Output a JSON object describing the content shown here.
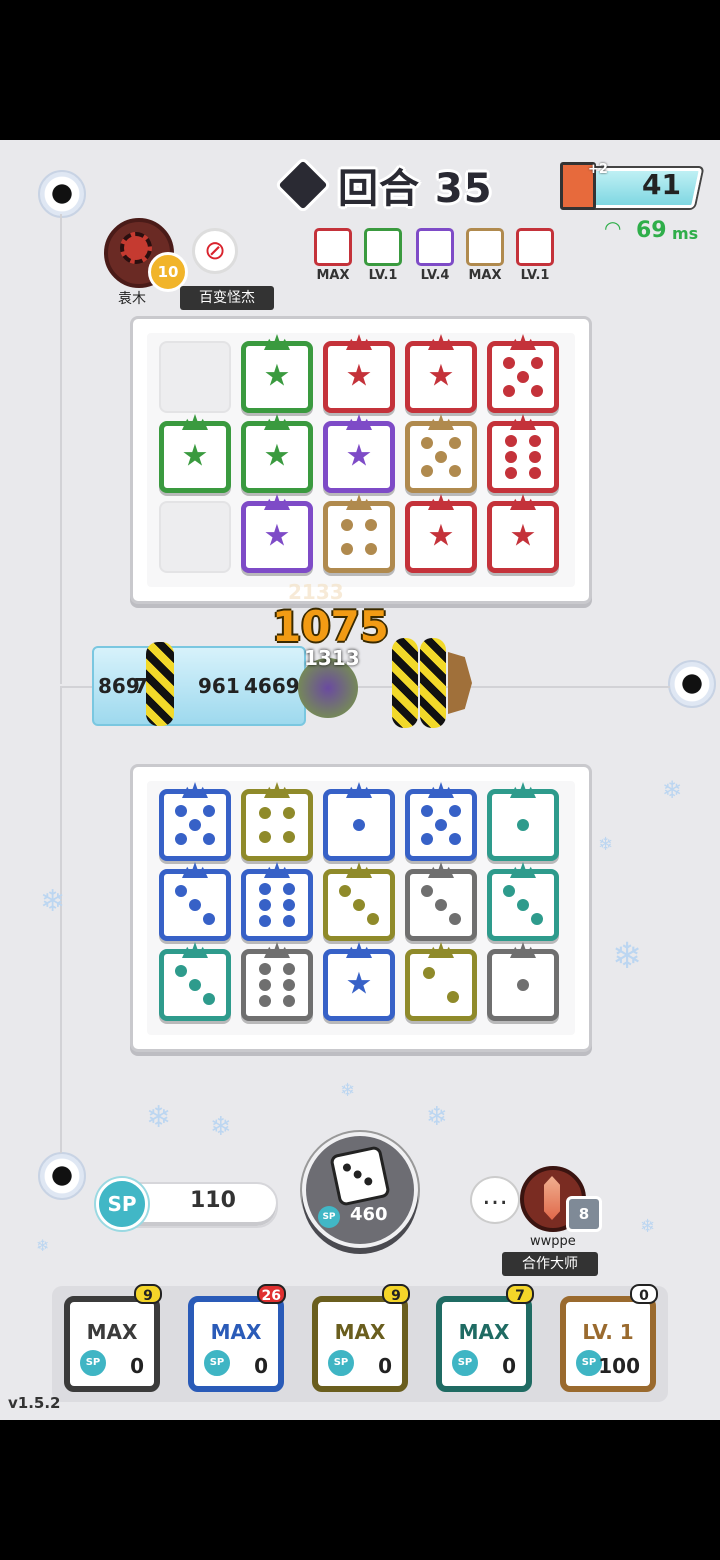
{
  "hud": {
    "round_label": "回合 35",
    "cards_bonus": "+2",
    "cards_count": "41",
    "ping_value": "69",
    "ping_unit": "ms"
  },
  "opponent": {
    "name": "袁木",
    "rank_level": "10",
    "title": "百变怪杰",
    "deck_levels": [
      "MAX",
      "LV.1",
      "LV.4",
      "MAX",
      "LV.1"
    ]
  },
  "battle": {
    "damage_big": "1075",
    "damage_small_a": "2133",
    "damage_small_b": "1313",
    "enemy_hp_left": "869",
    "enemy_hp_left_b": "7",
    "enemy_hp_mid": "961",
    "enemy_hp_right": "4669"
  },
  "player": {
    "sp_label": "SP",
    "sp_value": "110",
    "summon_cost": "460",
    "summon_sp": "SP",
    "teammate_name": "wwppe",
    "teammate_rank": "8",
    "teammate_title": "合作大师",
    "chat_icon": "…"
  },
  "hand": [
    {
      "level": "MAX",
      "sp": "SP",
      "cost": "0",
      "badge": "9",
      "color": "#3b3b3b"
    },
    {
      "level": "MAX",
      "sp": "SP",
      "cost": "0",
      "badge": "26",
      "color": "#2a5bb8"
    },
    {
      "level": "MAX",
      "sp": "SP",
      "cost": "0",
      "badge": "9",
      "color": "#6a5e1e"
    },
    {
      "level": "MAX",
      "sp": "SP",
      "cost": "0",
      "badge": "7",
      "color": "#1f6b63"
    },
    {
      "level": "LV. 1",
      "sp": "SP",
      "cost": "100",
      "badge": "0",
      "color": "#9a6a2e"
    }
  ],
  "version": "v1.5.2",
  "colors": {
    "green": "#3a9a3f",
    "red": "#c4323a",
    "purple": "#7e4bc7",
    "brown": "#b08a4e",
    "blue": "#3761c7",
    "olive": "#8f8a2a",
    "teal": "#2e9b8c",
    "gray": "#6f6f6f"
  }
}
